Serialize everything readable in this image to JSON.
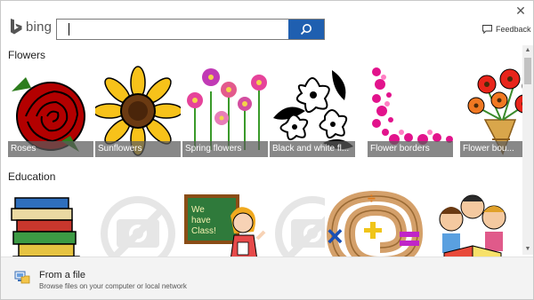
{
  "header": {
    "logo_text": "bing",
    "search_value": "",
    "feedback_label": "Feedback"
  },
  "categories": [
    {
      "title": "Flowers",
      "tiles": [
        {
          "caption": "Roses",
          "icon": "rose-image"
        },
        {
          "caption": "Sunflowers",
          "icon": "sunflower-image"
        },
        {
          "caption": "Spring flowers",
          "icon": "spring-flowers-image"
        },
        {
          "caption": "Black and white fl...",
          "icon": "black-white-flowers-image"
        },
        {
          "caption": "Flower borders",
          "icon": "flower-border-image"
        },
        {
          "caption": "Flower bou...",
          "icon": "flower-bouquet-image"
        }
      ]
    },
    {
      "title": "Education",
      "tiles": [
        {
          "caption": "",
          "icon": "books-image"
        },
        {
          "caption": "",
          "icon": "placeholder-camera-image"
        },
        {
          "caption": "",
          "icon": "teacher-chalkboard-image"
        },
        {
          "caption": "",
          "icon": "placeholder-camera-image"
        },
        {
          "caption": "",
          "icon": "math-symbols-image"
        },
        {
          "caption": "",
          "icon": "kids-reading-image"
        }
      ]
    }
  ],
  "footer": {
    "title": "From a file",
    "subtitle": "Browse files on your computer or local network"
  },
  "colors": {
    "accent": "#1f5fb0",
    "caption_bg": "#5a5a5a"
  }
}
